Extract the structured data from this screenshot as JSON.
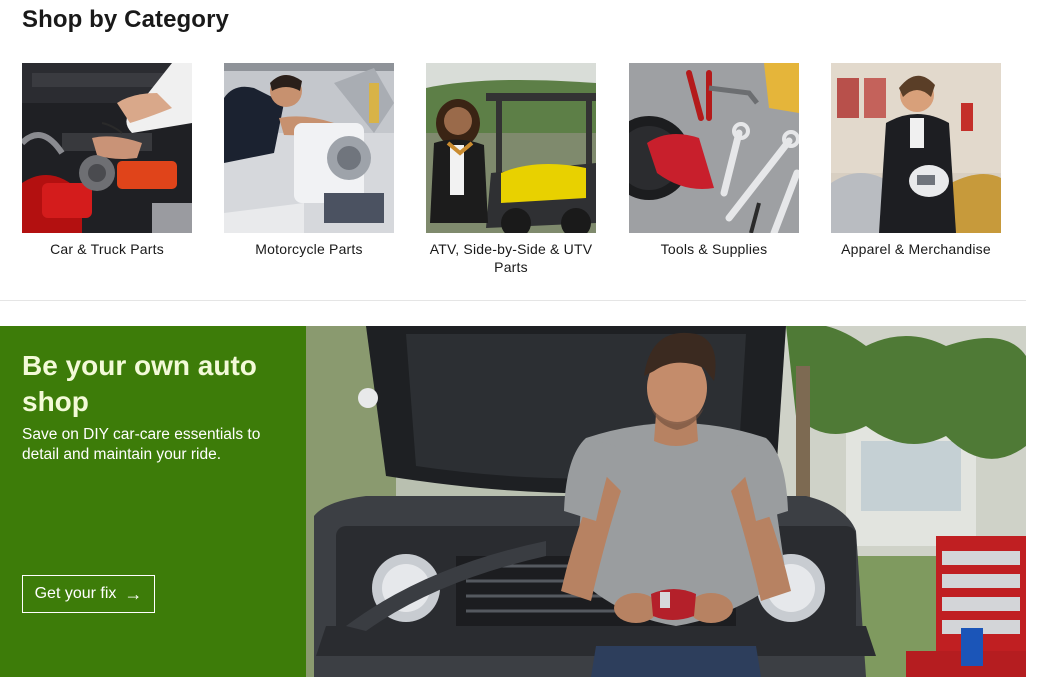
{
  "section": {
    "title": "Shop by Category"
  },
  "categories": [
    {
      "label": "Car & Truck Parts",
      "image": "car-engine-photo"
    },
    {
      "label": "Motorcycle Parts",
      "image": "motorcycle-mechanic-photo"
    },
    {
      "label": "ATV, Side-by-Side & UTV Parts",
      "image": "utv-woman-photo"
    },
    {
      "label": "Tools & Supplies",
      "image": "wrenches-tools-photo"
    },
    {
      "label": "Apparel & Merchandise",
      "image": "rider-helmet-photo"
    }
  ],
  "promo": {
    "title": "Be your own auto shop",
    "subtitle": "Save on DIY car-care essentials to detail and maintain your ride.",
    "cta_label": "Get your fix",
    "cta_icon": "arrow-right-icon",
    "image": "man-with-truck-photo",
    "panel_color": "#3d7c09",
    "title_color": "#f3fad8"
  }
}
